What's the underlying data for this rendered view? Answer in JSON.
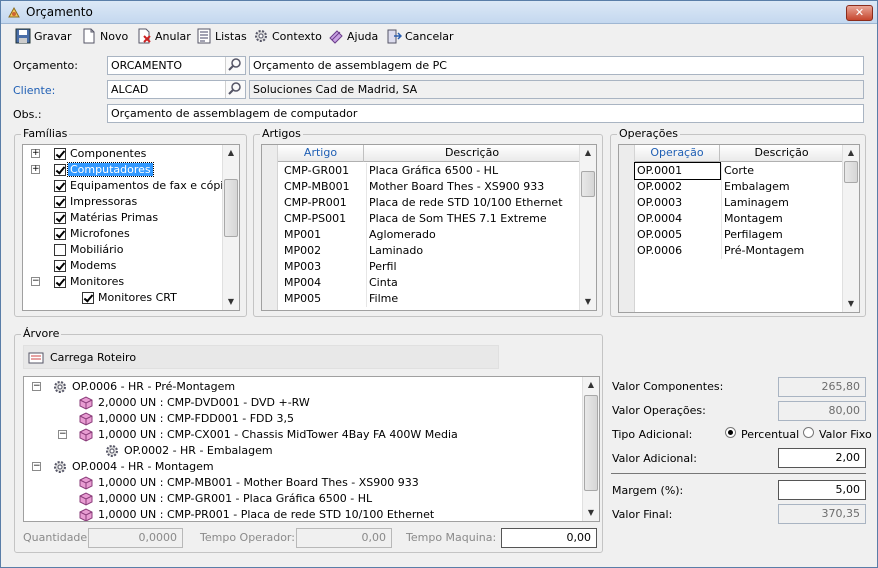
{
  "window": {
    "title": "Orçamento",
    "close_label": "✕"
  },
  "toolbar": [
    {
      "label": "Gravar",
      "icon": "save-icon"
    },
    {
      "label": "Novo",
      "icon": "new-document-icon"
    },
    {
      "label": "Anular",
      "icon": "cancel-document-icon"
    },
    {
      "label": "Listas",
      "icon": "list-icon"
    },
    {
      "label": "Contexto",
      "icon": "gear-icon"
    },
    {
      "label": "Ajuda",
      "icon": "help-icon"
    },
    {
      "label": "Cancelar",
      "icon": "exit-icon"
    }
  ],
  "header": {
    "orcamento_label": "Orçamento:",
    "orcamento_code": "ORCAMENTO",
    "orcamento_desc": "Orçamento de assemblagem de PC",
    "cliente_label": "Cliente:",
    "cliente_code": "ALCAD",
    "cliente_desc": "Soluciones Cad de Madrid, SA",
    "obs_label": "Obs.:",
    "obs_value": "Orçamento de assemblagem de computador"
  },
  "familias": {
    "title": "Famílias",
    "items": [
      {
        "label": "Componentes",
        "checked": true,
        "expander": "+",
        "level": 0
      },
      {
        "label": "Computadores",
        "checked": true,
        "expander": "+",
        "level": 0,
        "selected": true
      },
      {
        "label": "Equipamentos de fax e cópia",
        "checked": true,
        "level": 0
      },
      {
        "label": "Impressoras",
        "checked": true,
        "level": 0
      },
      {
        "label": "Matérias Primas",
        "checked": true,
        "level": 0
      },
      {
        "label": "Microfones",
        "checked": true,
        "level": 0
      },
      {
        "label": "Mobiliário",
        "checked": false,
        "level": 0
      },
      {
        "label": "Modems",
        "checked": true,
        "level": 0
      },
      {
        "label": "Monitores",
        "checked": true,
        "expander": "−",
        "level": 0
      },
      {
        "label": "Monitores CRT",
        "checked": true,
        "level": 1
      }
    ]
  },
  "artigos": {
    "title": "Artigos",
    "columns": [
      "Artigo",
      "Descrição"
    ],
    "rows": [
      [
        "CMP-GR001",
        "Placa Gráfica 6500 - HL"
      ],
      [
        "CMP-MB001",
        "Mother Board Thes - XS900 933"
      ],
      [
        "CMP-PR001",
        "Placa de rede STD 10/100 Ethernet"
      ],
      [
        "CMP-PS001",
        "Placa de Som THES 7.1 Extreme"
      ],
      [
        "MP001",
        "Aglomerado"
      ],
      [
        "MP002",
        "Laminado"
      ],
      [
        "MP003",
        "Perfil"
      ],
      [
        "MP004",
        "Cinta"
      ],
      [
        "MP005",
        "Filme"
      ]
    ]
  },
  "operacoes": {
    "title": "Operações",
    "columns": [
      "Operação",
      "Descrição"
    ],
    "rows": [
      [
        "OP.0001",
        "Corte"
      ],
      [
        "OP.0002",
        "Embalagem"
      ],
      [
        "OP.0003",
        "Laminagem"
      ],
      [
        "OP.0004",
        "Montagem"
      ],
      [
        "OP.0005",
        "Perfilagem"
      ],
      [
        "OP.0006",
        "Pré-Montagem"
      ]
    ]
  },
  "arvore": {
    "title": "Árvore",
    "load_button": "Carrega Roteiro",
    "nodes": [
      {
        "text": "OP.0006 - HR - Pré-Montagem",
        "type": "op",
        "level": 0,
        "expander": "−"
      },
      {
        "text": "2,0000 UN : CMP-DVD001 - DVD +-RW",
        "type": "item",
        "level": 1
      },
      {
        "text": "1,0000 UN : CMP-FDD001 - FDD 3,5",
        "type": "item",
        "level": 1
      },
      {
        "text": "1,0000 UN : CMP-CX001 - Chassis MidTower 4Bay FA 400W Media",
        "type": "item",
        "level": 1,
        "expander": "−"
      },
      {
        "text": "OP.0002 - HR - Embalagem",
        "type": "op",
        "level": 2
      },
      {
        "text": "OP.0004 - HR - Montagem",
        "type": "op",
        "level": 0,
        "expander": "−"
      },
      {
        "text": "1,0000 UN : CMP-MB001 - Mother Board Thes - XS900 933",
        "type": "item",
        "level": 1
      },
      {
        "text": "1,0000 UN : CMP-GR001 - Placa Gráfica 6500 - HL",
        "type": "item",
        "level": 1
      },
      {
        "text": "1,0000 UN : CMP-PR001 - Placa de rede STD 10/100 Ethernet",
        "type": "item",
        "level": 1
      }
    ],
    "quantidade_label": "Quantidade:",
    "quantidade_value": "0,0000",
    "tempo_operador_label": "Tempo Operador:",
    "tempo_operador_value": "0,00",
    "tempo_maquina_label": "Tempo Maquina:",
    "tempo_maquina_value": "0,00"
  },
  "totais": {
    "valor_componentes_label": "Valor Componentes:",
    "valor_componentes": "265,80",
    "valor_operacoes_label": "Valor Operações:",
    "valor_operacoes": "80,00",
    "tipo_adicional_label": "Tipo Adicional:",
    "percentual_label": "Percentual",
    "valor_fixo_label": "Valor Fixo",
    "tipo_selected": "Percentual",
    "valor_adicional_label": "Valor Adicional:",
    "valor_adicional": "2,00",
    "margem_label": "Margem (%):",
    "margem": "5,00",
    "valor_final_label": "Valor Final:",
    "valor_final": "370,35"
  },
  "colors": {
    "accent": "#3399ff",
    "header_link": "#1f5fb4",
    "title_bar": "#c4d8ef"
  }
}
